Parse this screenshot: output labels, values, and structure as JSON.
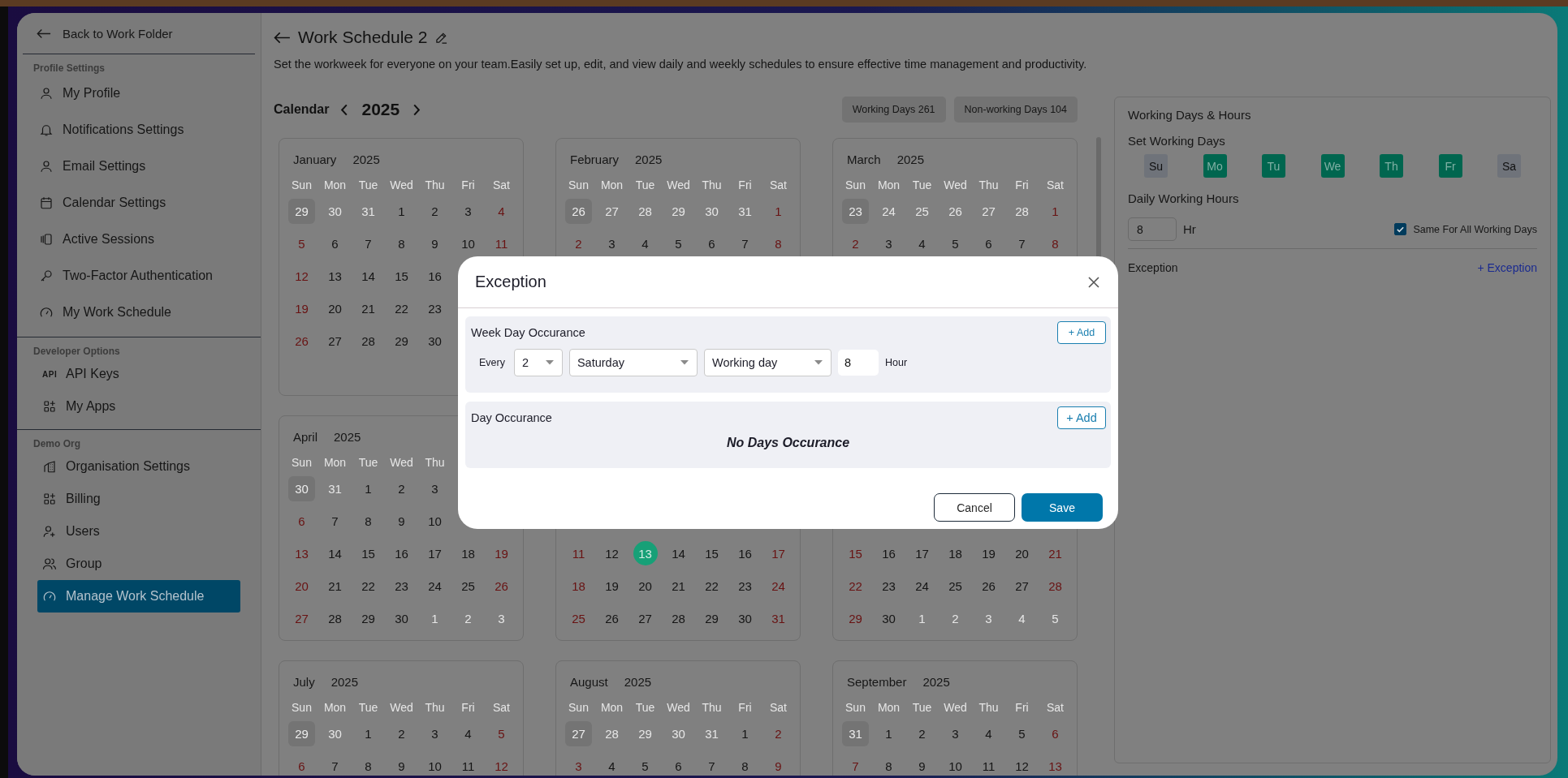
{
  "sidebar": {
    "back_link": "Back to Work Folder",
    "sections": [
      {
        "title": "Profile Settings",
        "items": [
          {
            "label": "My Profile",
            "selected": false
          },
          {
            "label": "Notifications Settings",
            "selected": false
          },
          {
            "label": "Email Settings",
            "selected": false
          },
          {
            "label": "Calendar Settings",
            "selected": false
          },
          {
            "label": "Active Sessions",
            "selected": false
          },
          {
            "label": "Two-Factor Authentication",
            "selected": false
          },
          {
            "label": "My Work Schedule",
            "selected": false
          }
        ]
      },
      {
        "title": "Developer Options",
        "items": [
          {
            "label": "API Keys",
            "icon_text": "API",
            "selected": false
          },
          {
            "label": "My Apps",
            "selected": false
          }
        ]
      },
      {
        "title": "Demo Org",
        "items": [
          {
            "label": "Organisation Settings",
            "selected": false
          },
          {
            "label": "Billing",
            "selected": false
          },
          {
            "label": "Users",
            "selected": false
          },
          {
            "label": "Group",
            "selected": false
          },
          {
            "label": "Manage Work Schedule",
            "selected": true
          }
        ]
      }
    ]
  },
  "header": {
    "title": "Work Schedule 2",
    "subtitle": "Set the workweek for everyone on your team.Easily set up, edit, and view daily and weekly schedules to ensure effective time management and productivity."
  },
  "calendar": {
    "label": "Calendar",
    "year": "2025",
    "badges": [
      "Working Days 261",
      "Non-working Days 104"
    ],
    "months": [
      {
        "month": "January",
        "year": "2025",
        "weekdays": [
          "Sun",
          "Mon",
          "Tue",
          "Wed",
          "Thu",
          "Fri",
          "Sat"
        ],
        "weeks": [
          {
            "kind": "shown",
            "days": [
              {
                "day": "29",
                "kind": "focus"
              },
              {
                "day": "30",
                "kind": "out"
              },
              {
                "day": "31",
                "kind": "out"
              },
              {
                "day": "1",
                "kind": "in"
              },
              {
                "day": "2",
                "kind": "in"
              },
              {
                "day": "3",
                "kind": "in"
              },
              {
                "day": "4",
                "kind": "in"
              }
            ]
          },
          {
            "kind": "shown",
            "days": [
              {
                "day": "5",
                "kind": "in"
              },
              {
                "day": "6",
                "kind": "in"
              },
              {
                "day": "7",
                "kind": "in"
              },
              {
                "day": "8",
                "kind": "in"
              },
              {
                "day": "9",
                "kind": "in"
              },
              {
                "day": "10",
                "kind": "in"
              },
              {
                "day": "11",
                "kind": "in"
              }
            ]
          },
          {
            "kind": "shown",
            "days": [
              {
                "day": "12",
                "kind": "in"
              },
              {
                "day": "13",
                "kind": "in"
              },
              {
                "day": "14",
                "kind": "in"
              },
              {
                "day": "15",
                "kind": "in"
              },
              {
                "day": "16",
                "kind": "in"
              }
            ]
          },
          {
            "kind": "shown",
            "days": [
              {
                "day": "19",
                "kind": "in"
              },
              {
                "day": "20",
                "kind": "in"
              },
              {
                "day": "21",
                "kind": "in"
              },
              {
                "day": "22",
                "kind": "in"
              },
              {
                "day": "23",
                "kind": "in"
              }
            ]
          },
          {
            "kind": "shown",
            "days": [
              {
                "day": "26",
                "kind": "in"
              },
              {
                "day": "27",
                "kind": "in"
              },
              {
                "day": "28",
                "kind": "in"
              },
              {
                "day": "29",
                "kind": "in"
              },
              {
                "day": "30",
                "kind": "in"
              }
            ]
          }
        ]
      },
      {
        "month": "February",
        "year": "2025",
        "weekdays": [
          "Sun",
          "Mon",
          "Tue",
          "Wed",
          "Thu",
          "Fri",
          "Sat"
        ],
        "weeks": [
          {
            "kind": "shown",
            "days": [
              {
                "day": "26",
                "kind": "focus"
              },
              {
                "day": "27",
                "kind": "out"
              },
              {
                "day": "28",
                "kind": "out"
              },
              {
                "day": "29",
                "kind": "out"
              },
              {
                "day": "30",
                "kind": "out"
              },
              {
                "day": "31",
                "kind": "out"
              },
              {
                "day": "1",
                "kind": "in"
              }
            ]
          },
          {
            "kind": "shown",
            "days": [
              {
                "day": "2",
                "kind": "in"
              },
              {
                "day": "3",
                "kind": "in"
              },
              {
                "day": "4",
                "kind": "in"
              },
              {
                "day": "5",
                "kind": "in"
              },
              {
                "day": "6",
                "kind": "in"
              },
              {
                "day": "7",
                "kind": "in"
              },
              {
                "day": "8",
                "kind": "in"
              }
            ]
          },
          {
            "kind": "hidden"
          },
          {
            "kind": "hidden"
          },
          {
            "kind": "hidden"
          }
        ]
      },
      {
        "month": "March",
        "year": "2025",
        "weekdays": [
          "Sun",
          "Mon",
          "Tue",
          "Wed",
          "Thu",
          "Fri",
          "Sat"
        ],
        "weeks": [
          {
            "kind": "shown",
            "days": [
              {
                "day": "23",
                "kind": "focus"
              },
              {
                "day": "24",
                "kind": "out"
              },
              {
                "day": "25",
                "kind": "out"
              },
              {
                "day": "26",
                "kind": "out"
              },
              {
                "day": "27",
                "kind": "out"
              },
              {
                "day": "28",
                "kind": "out"
              },
              {
                "day": "1",
                "kind": "in"
              }
            ]
          },
          {
            "kind": "shown",
            "days": [
              {
                "day": "2",
                "kind": "in"
              },
              {
                "day": "3",
                "kind": "in"
              },
              {
                "day": "4",
                "kind": "in"
              },
              {
                "day": "5",
                "kind": "in"
              },
              {
                "day": "6",
                "kind": "in"
              },
              {
                "day": "7",
                "kind": "in"
              },
              {
                "day": "8",
                "kind": "in"
              }
            ]
          },
          {
            "kind": "hidden"
          },
          {
            "kind": "hidden"
          },
          {
            "kind": "hidden"
          },
          {
            "kind": "hidden"
          }
        ]
      },
      {
        "month": "April",
        "year": "2025",
        "weekdays": [
          "Sun",
          "Mon",
          "Tue",
          "Wed",
          "Thu"
        ],
        "weeks": [
          {
            "kind": "shown",
            "days": [
              {
                "day": "30",
                "kind": "focus"
              },
              {
                "day": "31",
                "kind": "out"
              },
              {
                "day": "1",
                "kind": "in"
              },
              {
                "day": "2",
                "kind": "in"
              },
              {
                "day": "3",
                "kind": "in"
              }
            ]
          },
          {
            "kind": "shown",
            "days": [
              {
                "day": "6",
                "kind": "in"
              },
              {
                "day": "7",
                "kind": "in"
              },
              {
                "day": "8",
                "kind": "in"
              },
              {
                "day": "9",
                "kind": "in"
              },
              {
                "day": "10",
                "kind": "in"
              }
            ]
          },
          {
            "kind": "shown",
            "days": [
              {
                "day": "13",
                "kind": "in"
              },
              {
                "day": "14",
                "kind": "in"
              },
              {
                "day": "15",
                "kind": "in"
              },
              {
                "day": "16",
                "kind": "in"
              },
              {
                "day": "17",
                "kind": "in"
              },
              {
                "day": "18",
                "kind": "in"
              },
              {
                "day": "19",
                "kind": "in"
              }
            ]
          },
          {
            "kind": "shown",
            "days": [
              {
                "day": "20",
                "kind": "in"
              },
              {
                "day": "21",
                "kind": "in"
              },
              {
                "day": "22",
                "kind": "in"
              },
              {
                "day": "23",
                "kind": "in"
              },
              {
                "day": "24",
                "kind": "in"
              },
              {
                "day": "25",
                "kind": "in"
              },
              {
                "day": "26",
                "kind": "in"
              }
            ]
          },
          {
            "kind": "shown",
            "days": [
              {
                "day": "27",
                "kind": "in"
              },
              {
                "day": "28",
                "kind": "in"
              },
              {
                "day": "29",
                "kind": "in"
              },
              {
                "day": "30",
                "kind": "in"
              },
              {
                "day": "1",
                "kind": "out"
              },
              {
                "day": "2",
                "kind": "out"
              },
              {
                "day": "3",
                "kind": "out"
              }
            ]
          }
        ]
      },
      {
        "weeks": [
          {
            "kind": "hidden"
          },
          {
            "kind": "hidden"
          },
          {
            "kind": "shown",
            "days": [
              {
                "day": "11",
                "kind": "in"
              },
              {
                "day": "12",
                "kind": "in"
              },
              {
                "day": "13",
                "kind": "today"
              },
              {
                "day": "14",
                "kind": "in"
              },
              {
                "day": "15",
                "kind": "in"
              },
              {
                "day": "16",
                "kind": "in"
              },
              {
                "day": "17",
                "kind": "in"
              }
            ]
          },
          {
            "kind": "shown",
            "days": [
              {
                "day": "18",
                "kind": "in"
              },
              {
                "day": "19",
                "kind": "in"
              },
              {
                "day": "20",
                "kind": "in"
              },
              {
                "day": "21",
                "kind": "in"
              },
              {
                "day": "22",
                "kind": "in"
              },
              {
                "day": "23",
                "kind": "in"
              },
              {
                "day": "24",
                "kind": "in"
              }
            ]
          },
          {
            "kind": "shown",
            "days": [
              {
                "day": "25",
                "kind": "in"
              },
              {
                "day": "26",
                "kind": "in"
              },
              {
                "day": "27",
                "kind": "in"
              },
              {
                "day": "28",
                "kind": "in"
              },
              {
                "day": "29",
                "kind": "in"
              },
              {
                "day": "30",
                "kind": "in"
              },
              {
                "day": "31",
                "kind": "in"
              }
            ]
          }
        ]
      },
      {
        "weeks": [
          {
            "kind": "hidden"
          },
          {
            "kind": "hidden"
          },
          {
            "kind": "shown",
            "days": [
              {
                "day": "15",
                "kind": "in"
              },
              {
                "day": "16",
                "kind": "in"
              },
              {
                "day": "17",
                "kind": "in"
              },
              {
                "day": "18",
                "kind": "in"
              },
              {
                "day": "19",
                "kind": "in"
              },
              {
                "day": "20",
                "kind": "in"
              },
              {
                "day": "21",
                "kind": "in"
              }
            ]
          },
          {
            "kind": "shown",
            "days": [
              {
                "day": "22",
                "kind": "in"
              },
              {
                "day": "23",
                "kind": "in"
              },
              {
                "day": "24",
                "kind": "in"
              },
              {
                "day": "25",
                "kind": "in"
              },
              {
                "day": "26",
                "kind": "in"
              },
              {
                "day": "27",
                "kind": "in"
              },
              {
                "day": "28",
                "kind": "in"
              }
            ]
          },
          {
            "kind": "shown",
            "days": [
              {
                "day": "29",
                "kind": "in"
              },
              {
                "day": "30",
                "kind": "in"
              },
              {
                "day": "1",
                "kind": "out"
              },
              {
                "day": "2",
                "kind": "out"
              },
              {
                "day": "3",
                "kind": "out"
              },
              {
                "day": "4",
                "kind": "out"
              },
              {
                "day": "5",
                "kind": "out"
              }
            ]
          }
        ]
      },
      {
        "month": "July",
        "year": "2025",
        "weekdays": [
          "Sun",
          "Mon",
          "Tue",
          "Wed",
          "Thu",
          "Fri",
          "Sat"
        ],
        "weeks": [
          {
            "kind": "shown",
            "days": [
              {
                "day": "29",
                "kind": "focus"
              },
              {
                "day": "30",
                "kind": "out"
              },
              {
                "day": "1",
                "kind": "in"
              },
              {
                "day": "2",
                "kind": "in"
              },
              {
                "day": "3",
                "kind": "in"
              },
              {
                "day": "4",
                "kind": "in"
              },
              {
                "day": "5",
                "kind": "in"
              }
            ]
          },
          {
            "kind": "shown",
            "days": [
              {
                "day": "6",
                "kind": "in"
              },
              {
                "day": "7",
                "kind": "in"
              },
              {
                "day": "8",
                "kind": "in"
              },
              {
                "day": "9",
                "kind": "in"
              },
              {
                "day": "10",
                "kind": "in"
              },
              {
                "day": "11",
                "kind": "in"
              },
              {
                "day": "12",
                "kind": "in"
              }
            ]
          }
        ]
      },
      {
        "month": "August",
        "year": "2025",
        "weekdays": [
          "Sun",
          "Mon",
          "Tue",
          "Wed",
          "Thu",
          "Fri",
          "Sat"
        ],
        "weeks": [
          {
            "kind": "shown",
            "days": [
              {
                "day": "27",
                "kind": "focus"
              },
              {
                "day": "28",
                "kind": "out"
              },
              {
                "day": "29",
                "kind": "out"
              },
              {
                "day": "30",
                "kind": "out"
              },
              {
                "day": "31",
                "kind": "out"
              },
              {
                "day": "1",
                "kind": "in"
              },
              {
                "day": "2",
                "kind": "in"
              }
            ]
          },
          {
            "kind": "shown",
            "days": [
              {
                "day": "3",
                "kind": "in"
              },
              {
                "day": "4",
                "kind": "in"
              },
              {
                "day": "5",
                "kind": "in"
              },
              {
                "day": "6",
                "kind": "in"
              },
              {
                "day": "7",
                "kind": "in"
              },
              {
                "day": "8",
                "kind": "in"
              },
              {
                "day": "9",
                "kind": "in"
              }
            ]
          }
        ]
      },
      {
        "month": "September",
        "year": "2025",
        "weekdays": [
          "Sun",
          "Mon",
          "Tue",
          "Wed",
          "Thu",
          "Fri",
          "Sat"
        ],
        "weeks": [
          {
            "kind": "shown",
            "days": [
              {
                "day": "31",
                "kind": "focus"
              },
              {
                "day": "1",
                "kind": "in"
              },
              {
                "day": "2",
                "kind": "in"
              },
              {
                "day": "3",
                "kind": "in"
              },
              {
                "day": "4",
                "kind": "in"
              },
              {
                "day": "5",
                "kind": "in"
              },
              {
                "day": "6",
                "kind": "in"
              }
            ]
          },
          {
            "kind": "shown",
            "days": [
              {
                "day": "7",
                "kind": "in"
              },
              {
                "day": "8",
                "kind": "in"
              },
              {
                "day": "9",
                "kind": "in"
              },
              {
                "day": "10",
                "kind": "in"
              },
              {
                "day": "11",
                "kind": "in"
              },
              {
                "day": "12",
                "kind": "in"
              },
              {
                "day": "13",
                "kind": "in"
              }
            ]
          }
        ]
      }
    ]
  },
  "right_panel": {
    "title": "Working Days & Hours",
    "set_days_label": "Set Working Days",
    "days": [
      {
        "label": "Su",
        "selected": false
      },
      {
        "label": "Mo",
        "selected": true
      },
      {
        "label": "Tu",
        "selected": true
      },
      {
        "label": "We",
        "selected": true
      },
      {
        "label": "Th",
        "selected": true
      },
      {
        "label": "Fr",
        "selected": true
      },
      {
        "label": "Sa",
        "selected": false
      }
    ],
    "hours_label": "Daily Working Hours",
    "hours": "8",
    "hours_unit": "Hr",
    "same_for_all": {
      "label": "Same For All Working Days",
      "checked": true
    },
    "exception_label": "Exception",
    "add_exception": "+ Exception"
  },
  "modal": {
    "title": "Exception",
    "week_day": {
      "title": "Week Day Occurance",
      "add": "+ Add",
      "every": "Every",
      "count": "2",
      "weekday": "Saturday",
      "day_type": "Working day",
      "hours": "8",
      "unit": "Hour"
    },
    "day": {
      "title": "Day Occurance",
      "add": "+ Add",
      "empty": "No Days Occurance"
    },
    "buttons": {
      "cancel": "Cancel",
      "save": "Save"
    }
  }
}
